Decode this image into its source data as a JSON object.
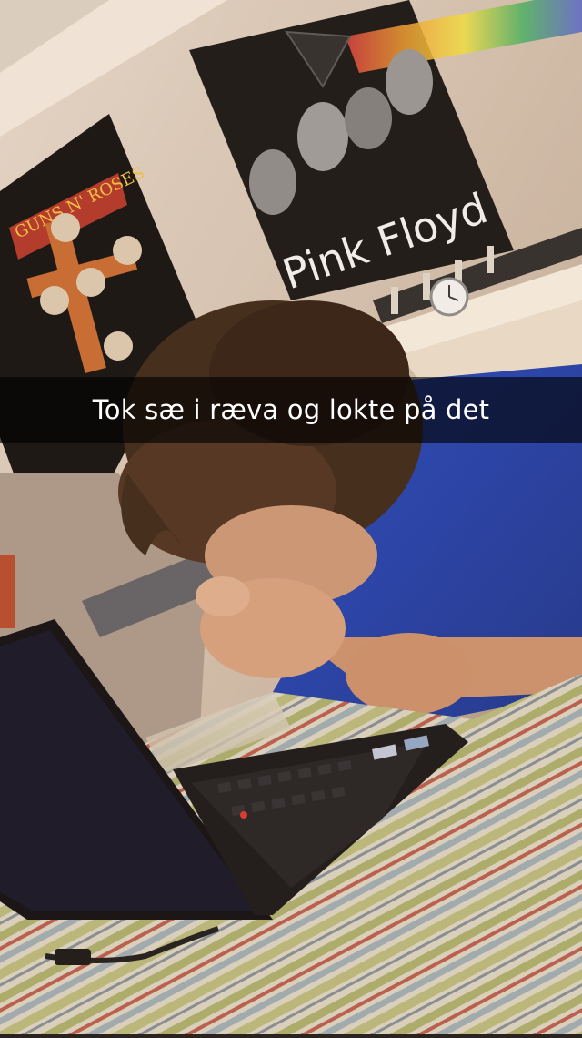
{
  "snap": {
    "caption": "Tok sæ i ræva og lokte på det"
  },
  "photo": {
    "poster_right_text": "Pink Floyd",
    "poster_left_text": "GUNS N' ROSES"
  },
  "colors": {
    "caption_bar": "#000000",
    "caption_text": "#ffffff",
    "shirt": "#1c3fb0",
    "wall": "#cdbfb0"
  }
}
